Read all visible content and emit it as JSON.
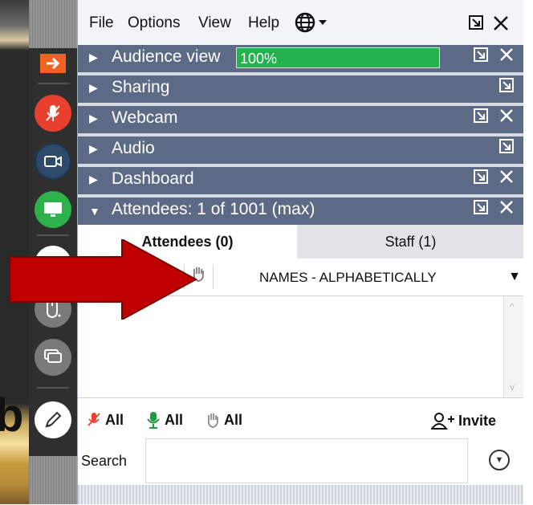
{
  "menu": {
    "file": "File",
    "options": "Options",
    "view": "View",
    "help": "Help",
    "globe_icon": "globe-icon"
  },
  "sections": {
    "audience_view": {
      "label": "Audience view",
      "progress_text": "100%",
      "progress": 1.0
    },
    "sharing": {
      "label": "Sharing"
    },
    "webcam": {
      "label": "Webcam"
    },
    "audio": {
      "label": "Audio"
    },
    "dashboard": {
      "label": "Dashboard"
    },
    "attendees": {
      "label": "Attendees:  1 of 1001 (max)"
    }
  },
  "tabs": {
    "attendees": "Attendees (0)",
    "staff": "Staff (1)"
  },
  "sort": {
    "label": "NAMES - ALPHABETICALLY"
  },
  "controls": {
    "mute_all": "All",
    "unmute_all": "All",
    "hands_all": "All",
    "invite": "Invite",
    "search_label": "Search"
  },
  "colors": {
    "section_header": "#5d6a86",
    "progress_fill": "#22b14c",
    "mic_muted": "#e8402d",
    "mic_on": "#2eb14a",
    "annotation_arrow": "#c00000"
  }
}
